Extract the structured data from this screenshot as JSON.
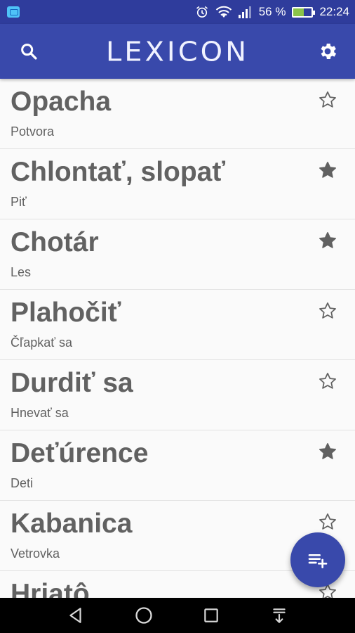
{
  "status_bar": {
    "battery_percent": "56 %",
    "battery_level": 0.56,
    "time": "22:24",
    "icons": [
      "notification-icon",
      "alarm-icon",
      "wifi-icon",
      "signal-icon",
      "battery-icon"
    ]
  },
  "app_bar": {
    "title": "LEXICON",
    "search_icon": "search-icon",
    "settings_icon": "gear-icon"
  },
  "words": [
    {
      "word": "Opacha",
      "translation": "Potvora",
      "starred": false
    },
    {
      "word": "Chlontať, slopať",
      "translation": "Piť",
      "starred": true
    },
    {
      "word": "Chotár",
      "translation": "Les",
      "starred": true
    },
    {
      "word": "Plahočiť",
      "translation": "Čľapkať sa",
      "starred": false
    },
    {
      "word": "Durdiť sa",
      "translation": "Hnevať sa",
      "starred": false
    },
    {
      "word": "Deťúrence",
      "translation": "Deti",
      "starred": true
    },
    {
      "word": "Kabanica",
      "translation": "Vetrovka",
      "starred": false
    },
    {
      "word": "Hriatô",
      "translation": "",
      "starred": false
    }
  ],
  "fab": {
    "icon": "playlist-add-icon"
  },
  "nav_bar": {
    "icons": [
      "back-icon",
      "home-icon",
      "recents-icon",
      "notifications-pull-icon"
    ]
  },
  "colors": {
    "status_bar": "#2f3c9c",
    "app_bar": "#3949ab",
    "text": "#616161",
    "accent": "#3949ab"
  }
}
